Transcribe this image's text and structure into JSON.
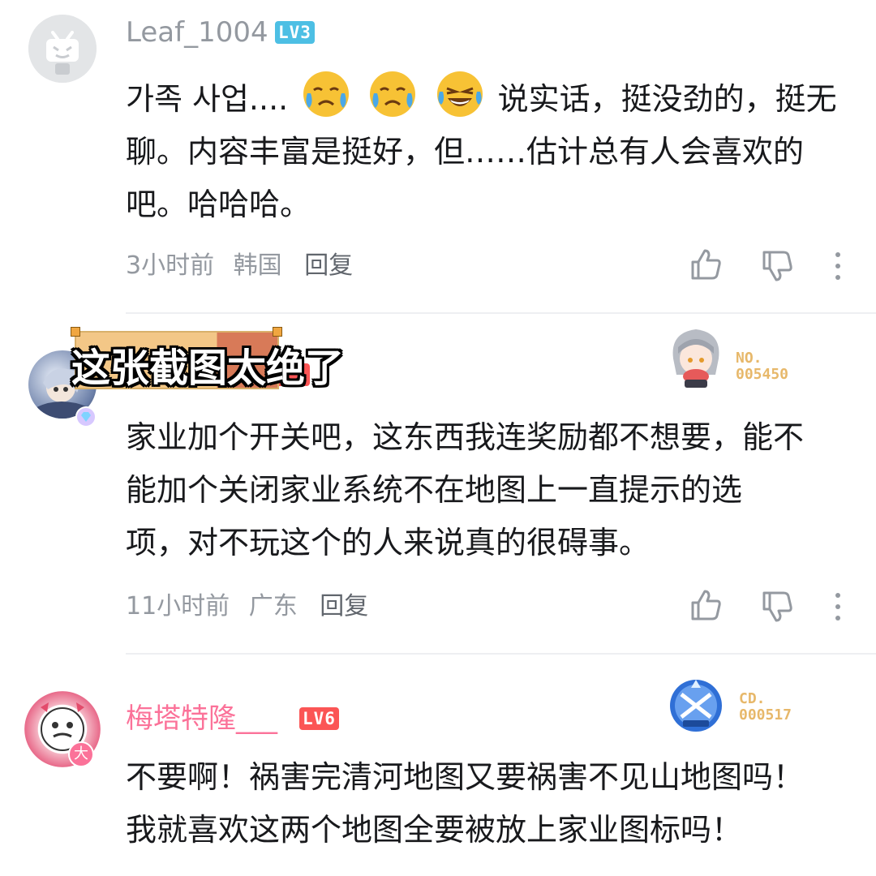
{
  "comments": [
    {
      "username": "Leaf_1004",
      "level": "LV3",
      "content_line1_pre": "가족 사업....",
      "content_line1_post": "说实话，挺没劲的，挺无",
      "content_line2": "聊。内容丰富是挺好，但……估计总有人会喜欢的",
      "content_line3": "吧。哈哈哈。",
      "time": "3小时前",
      "location": "韩国",
      "reply": "回复"
    },
    {
      "username": "",
      "fan_label": "NO.",
      "fan_number": "005450",
      "content_line1": "家业加个开关吧，这东西我连奖励都不想要，能不",
      "content_line2": "能加个关闭家业系统不在地图上一直提示的选",
      "content_line3": "项，对不玩这个的人来说真的很碍事。",
      "time": "11小时前",
      "location": "广东",
      "reply": "回复"
    },
    {
      "username": "梅塔特隆___",
      "level": "LV6",
      "avatar_badge": "大",
      "fan_label": "CD.",
      "fan_number": "000517",
      "content_line1": "不要啊！祸害完清河地图又要祸害不见山地图吗！",
      "content_line2": "我就喜欢这两个地图全要被放上家业图标吗！"
    }
  ],
  "overlay_caption": "这张截图太绝了",
  "colors": {
    "vip_pink": "#fb7299",
    "lv3": "#4dbfe4",
    "lv6": "#fb5555",
    "meta_gray": "#9499a0",
    "fan_gold": "#e7b86a"
  },
  "icons": [
    "bilibili-default-avatar-icon",
    "crying-laughing-emoji-icon",
    "thumbs-up-icon",
    "thumbs-down-icon",
    "more-vertical-icon"
  ]
}
